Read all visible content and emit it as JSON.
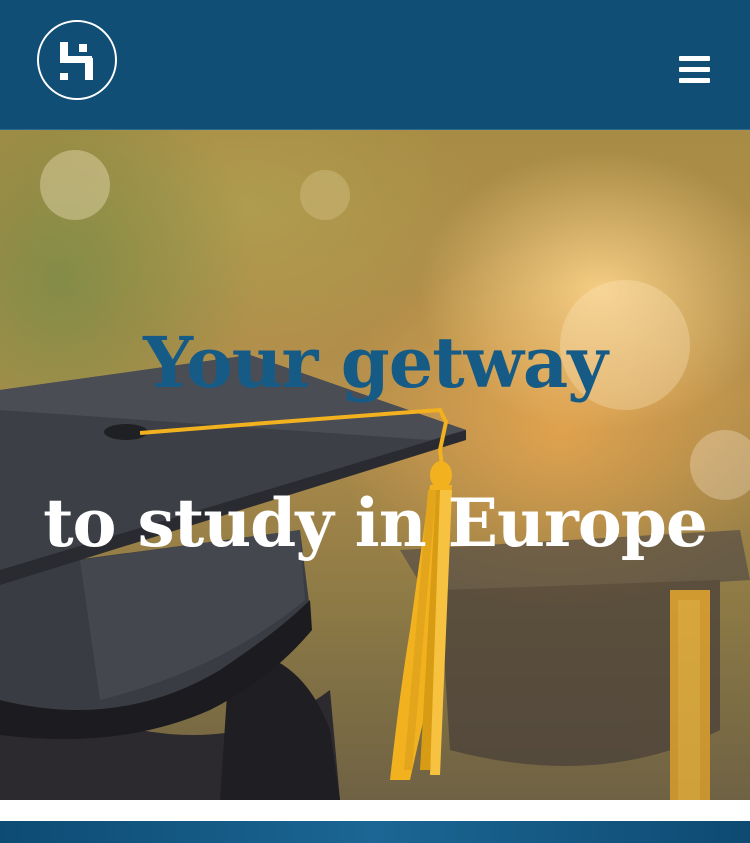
{
  "header": {
    "logo_name": "logo-s-circle",
    "menu_icon": "hamburger-menu-icon"
  },
  "hero": {
    "headline_line1": "Your getway",
    "headline_line2": "to study in Europe"
  },
  "colors": {
    "header_bg": "#104e75",
    "headline_blue": "#165b86",
    "headline_white": "#ffffff",
    "tassel_gold": "#f2b11f"
  }
}
